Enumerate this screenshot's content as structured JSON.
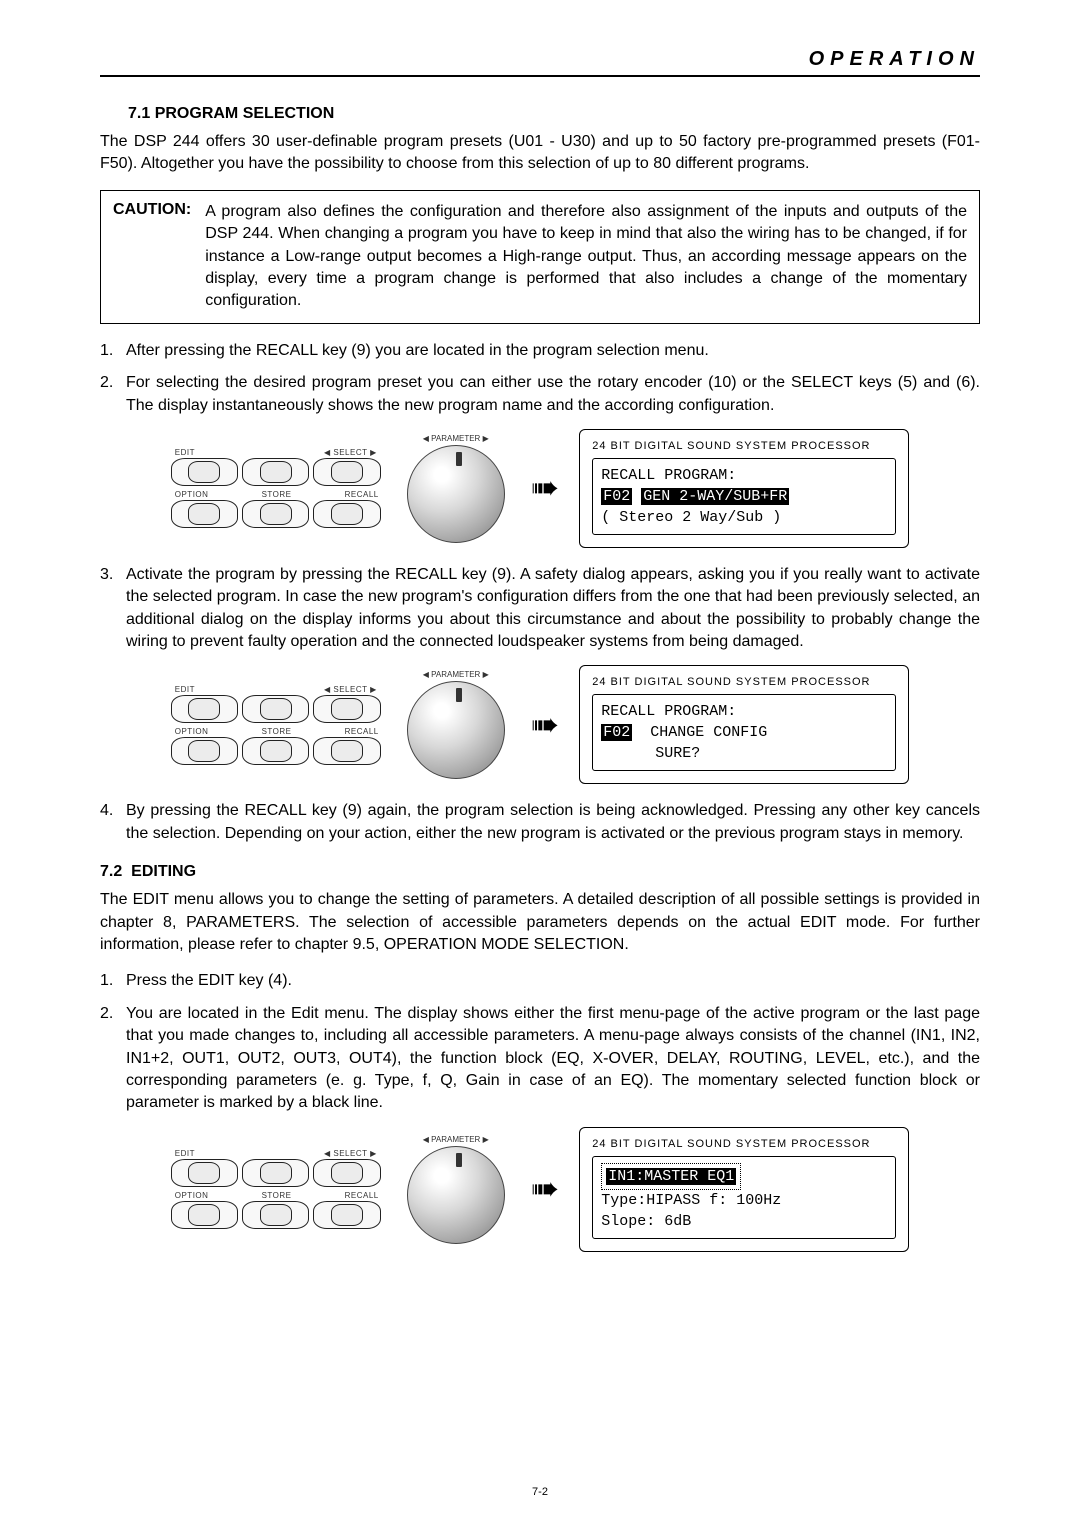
{
  "header": {
    "title": "OPERATION"
  },
  "section71": {
    "number": "7.1",
    "title": "PROGRAM SELECTION",
    "intro": "The DSP 244 offers 30 user-definable program presets (U01 - U30) and up to 50 factory pre-programmed presets (F01-F50). Altogether you have the possibility to choose from this selection of up to 80 different programs.",
    "caution_label": "CAUTION:",
    "caution_text": "A program also defines the configuration and therefore also assignment of the inputs and outputs of the DSP 244. When changing a program you have to keep in mind that also the wiring has to be changed, if for instance a Low-range output becomes a High-range output. Thus, an according message appears on the display, every time a program change is performed that also includes a change of the momentary configuration.",
    "steps": [
      "After pressing the RECALL key (9) you are located in the program selection menu.",
      "For selecting the desired program preset you can either use the rotary encoder (10) or the SELECT keys (5) and (6). The display instantaneously shows the new program name and the according configuration.",
      "Activate the program by pressing the RECALL key (9). A safety dialog appears, asking you if you really want to activate the selected program. In case the new program's configuration differs from the one that had been previously selected, an additional dialog on the display informs you about this circumstance and about the possibility to probably change the wiring to prevent faulty operation and the connected loudspeaker systems from being damaged.",
      "By pressing the RECALL key (9) again, the program selection is being acknowledged. Pressing any other key cancels the selection. Depending on your action, either the new program is activated or the previous program stays in memory."
    ]
  },
  "section72": {
    "number": "7.2",
    "title": "EDITING",
    "intro": "The EDIT menu allows you to change the setting of parameters. A detailed description of all possible settings is provided in chapter 8, PARAMETERS. The selection of accessible parameters depends on the actual EDIT mode. For further information, please refer to chapter 9.5, OPERATION MODE SELECTION.",
    "steps": [
      "Press the EDIT key (4).",
      "You are located in the Edit menu. The display shows either the first menu-page of the active program or the last page that you made changes to, including all accessible parameters. A menu-page always consists of the channel (IN1, IN2, IN1+2, OUT1, OUT2, OUT3, OUT4), the function block (EQ, X-OVER, DELAY, ROUTING, LEVEL, etc.), and the corresponding parameters (e. g. Type, f, Q, Gain in case of an EQ). The momentary selected function block or parameter is marked by a black line."
    ]
  },
  "panel": {
    "labels": {
      "edit": "EDIT",
      "select": "SELECT",
      "option": "OPTION",
      "store": "STORE",
      "recall": "RECALL",
      "parameter": "PARAMETER"
    }
  },
  "lcd": {
    "header": "24 BIT DIGITAL SOUND SYSTEM PROCESSOR",
    "recall1": {
      "line1": "RECALL PROGRAM:",
      "tag": "F02",
      "line2": "GEN 2-WAY/SUB+FR",
      "line3": "( Stereo 2 Way/Sub )"
    },
    "recall2": {
      "line1": "RECALL PROGRAM:",
      "tag": "F02",
      "line2": "  CHANGE CONFIG",
      "line3": "      SURE?"
    },
    "edit": {
      "line1a": "IN1:MASTER EQ1",
      "line2": "Type:HIPASS f: 100Hz",
      "line3": "Slope: 6dB"
    }
  },
  "page_number": "7-2"
}
